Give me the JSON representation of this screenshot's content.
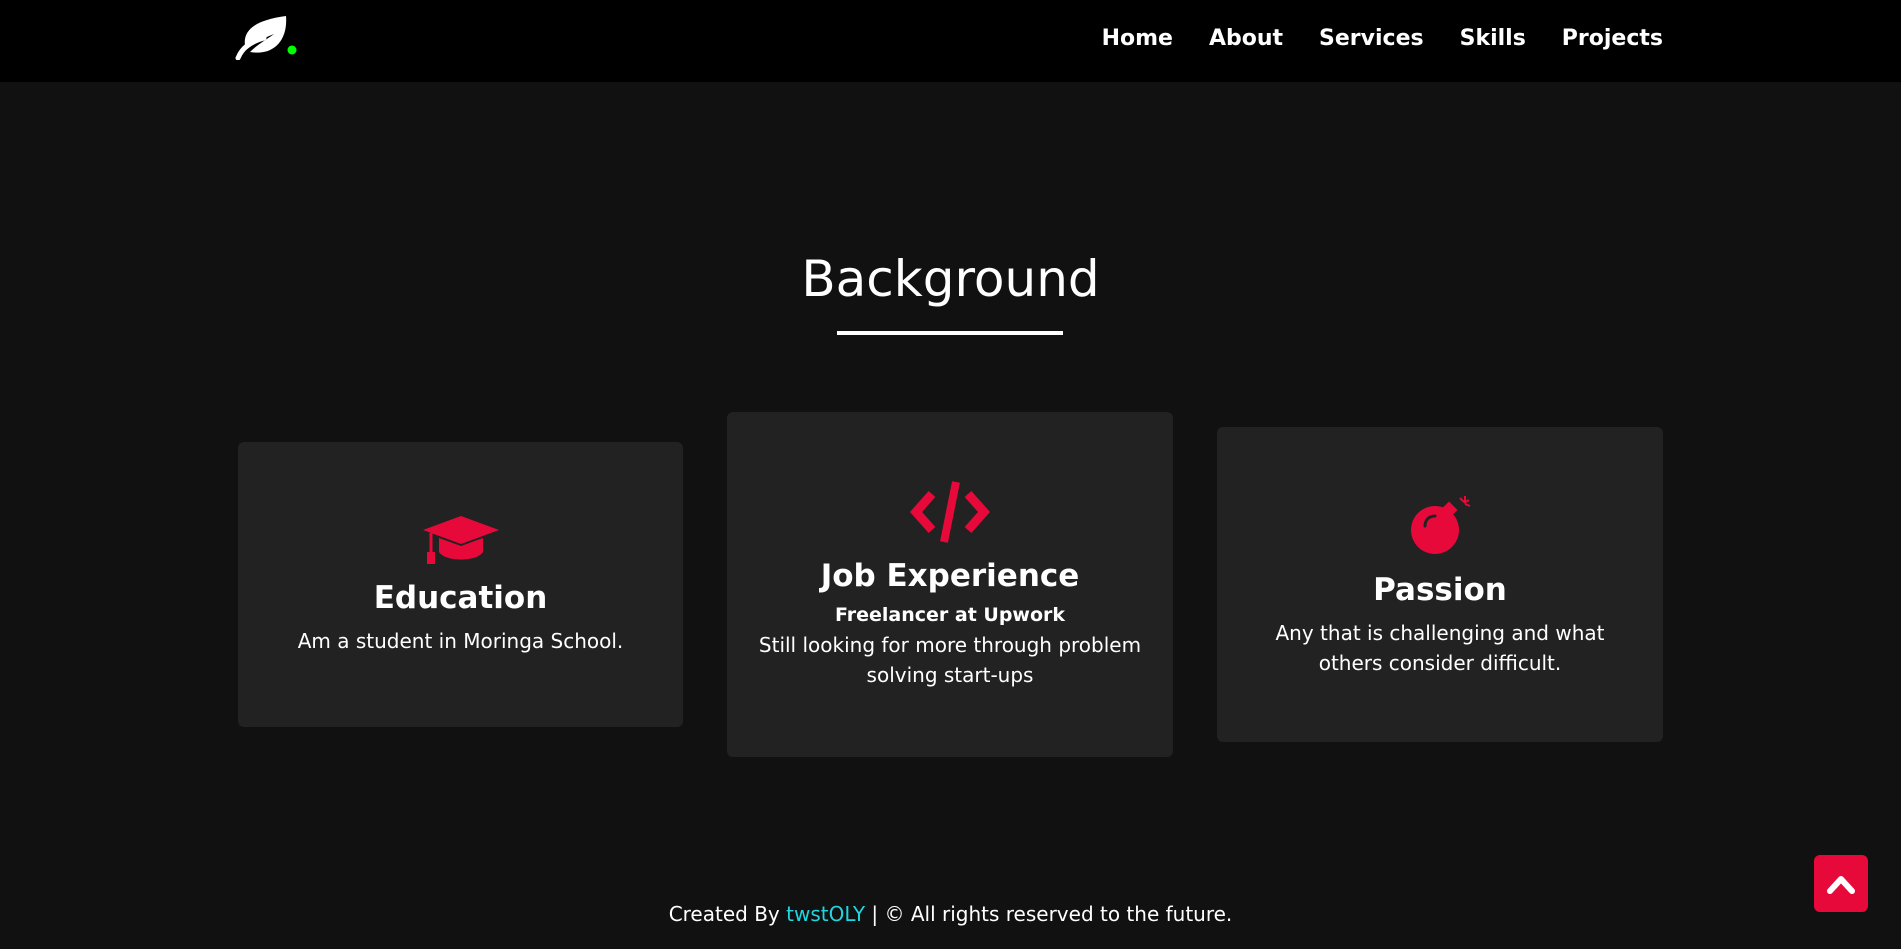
{
  "nav": {
    "logo_icon": "leaf-icon",
    "links": [
      "Home",
      "About",
      "Services",
      "Skills",
      "Projects"
    ]
  },
  "section": {
    "title": "Background"
  },
  "cards": {
    "education": {
      "icon": "graduation-cap-icon",
      "title": "Education",
      "text": "Am a student in Moringa School."
    },
    "job": {
      "icon": "code-icon",
      "title": "Job Experience",
      "subtitle": "Freelancer at Upwork",
      "text": "Still looking for more through problem solving start-ups"
    },
    "passion": {
      "icon": "bomb-icon",
      "title": "Passion",
      "text": "Any that is challenging and what others consider difficult."
    }
  },
  "footer": {
    "prefix": "Created By",
    "author": "twstOLY",
    "suffix": "| © All rights reserved to the future."
  },
  "scroll_top": {
    "icon": "chevron-up-icon"
  },
  "colors": {
    "accent": "#e8093b",
    "link": "#1fd6e0",
    "logo_dot": "#00ff00",
    "background": "#111111",
    "card": "#222222",
    "nav": "#000000"
  }
}
